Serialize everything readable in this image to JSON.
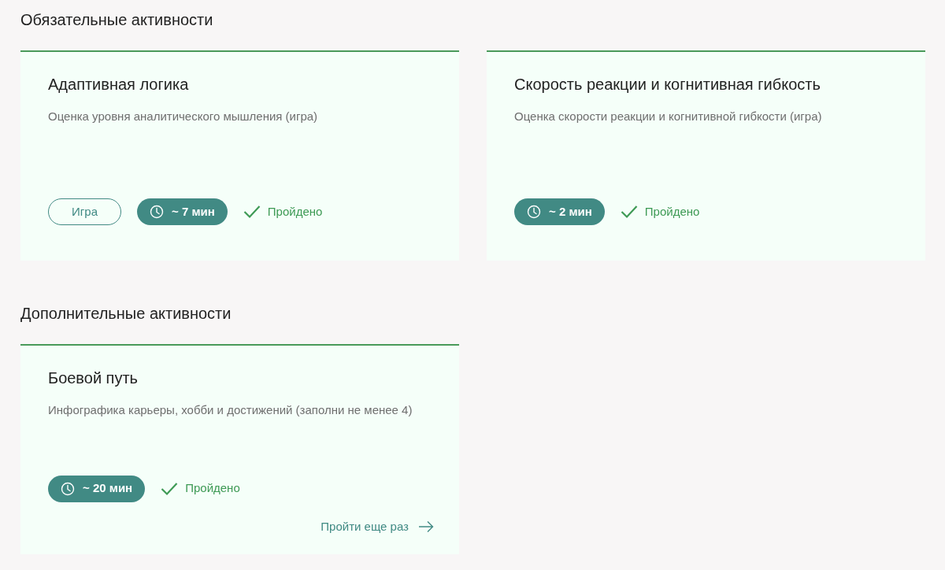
{
  "sections": [
    {
      "title": "Обязательные активности",
      "cards": [
        {
          "title": "Адаптивная логика",
          "description": "Оценка уровня аналитического мышления (игра)",
          "tag": "Игра",
          "duration": "~ 7 мин",
          "completed": true,
          "status": "Пройдено"
        },
        {
          "title": "Скорость реакции и когнитивная гибкость",
          "description": "Оценка скорости реакции и когнитивной гибкости (игра)",
          "duration": "~ 2 мин",
          "completed": true,
          "status": "Пройдено"
        }
      ]
    },
    {
      "title": "Дополнительные активности",
      "cards": [
        {
          "title": "Боевой путь",
          "description": "Инфографика карьеры, хобби и достижений (заполни не менее 4)",
          "duration": "~ 20 мин",
          "completed": true,
          "status": "Пройдено",
          "retry": "Пройти еще раз"
        }
      ]
    }
  ]
}
